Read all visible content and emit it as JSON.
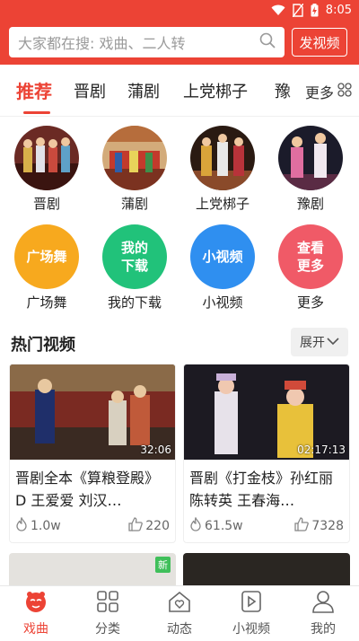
{
  "status_bar": {
    "time": "8:05",
    "icons": [
      "wifi-icon",
      "no-sim-icon",
      "battery-charging-icon"
    ]
  },
  "search": {
    "placeholder": "大家都在搜: 戏曲、二人转",
    "post_label": "发视频"
  },
  "tabs": {
    "items": [
      "推荐",
      "晋剧",
      "蒲剧",
      "上党梆子",
      "豫"
    ],
    "active": "推荐",
    "more_label": "更多"
  },
  "categories": [
    {
      "label": "晋剧"
    },
    {
      "label": "蒲剧"
    },
    {
      "label": "上党梆子"
    },
    {
      "label": "豫剧"
    }
  ],
  "features": [
    {
      "icon_text": "广场舞",
      "label": "广场舞",
      "color": "#f7a91e"
    },
    {
      "icon_text": "我的\n下载",
      "label": "我的下载",
      "color": "#21c27a"
    },
    {
      "icon_text": "小视频",
      "label": "小视频",
      "color": "#2f8ff0"
    },
    {
      "icon_text": "查看\n更多",
      "label": "更多",
      "color": "#f05a67"
    }
  ],
  "hot": {
    "title": "热门视频",
    "expand_label": "展开"
  },
  "videos": [
    {
      "title": "晋剧全本《算粮登殿》D 王爱爱 刘汉…",
      "duration": "32:06",
      "views": "1.0w",
      "likes": "220"
    },
    {
      "title": "晋剧《打金枝》孙红丽 陈转英 王春海…",
      "duration": "02:17:13",
      "views": "61.5w",
      "likes": "7328"
    }
  ],
  "partial_cards": {
    "badge": "新"
  },
  "bottom_nav": [
    {
      "label": "戏曲",
      "icon": "opera-mask-icon",
      "active": true
    },
    {
      "label": "分类",
      "icon": "grid-icon",
      "active": false
    },
    {
      "label": "动态",
      "icon": "house-heart-icon",
      "active": false
    },
    {
      "label": "小视频",
      "icon": "play-icon",
      "active": false
    },
    {
      "label": "我的",
      "icon": "person-icon",
      "active": false
    }
  ],
  "colors": {
    "accent": "#ec4335"
  }
}
